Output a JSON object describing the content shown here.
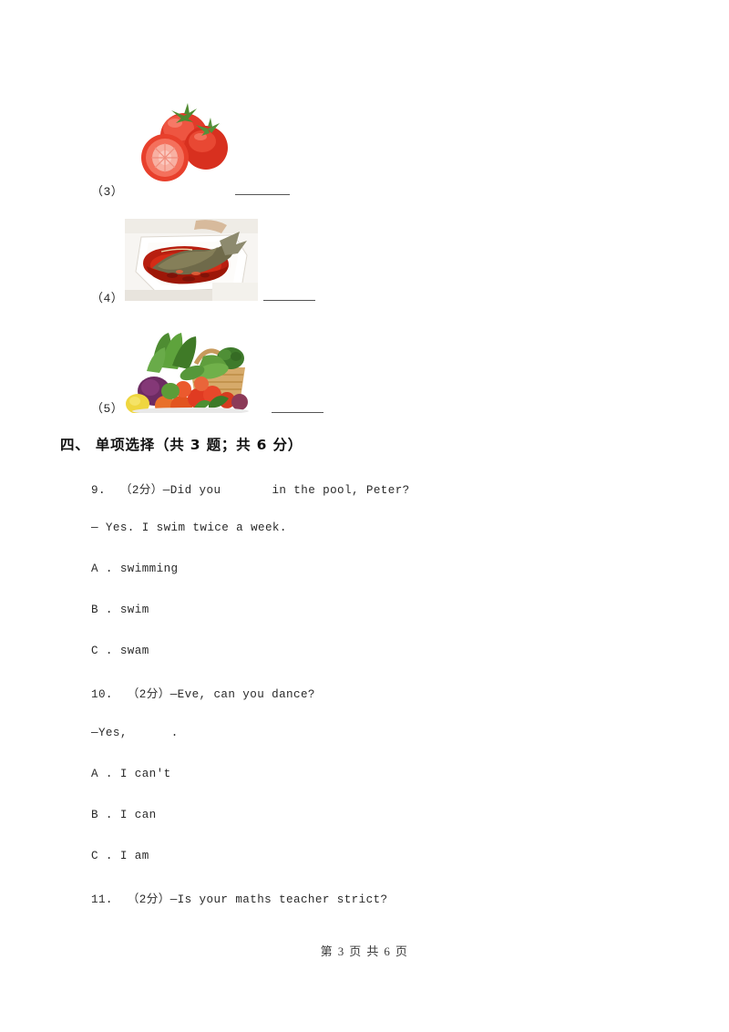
{
  "document": {
    "type": "exam-paper",
    "background_color": "#ffffff",
    "text_color": "#2a2a2a"
  },
  "picture_items": [
    {
      "label": "（3）",
      "image": "tomatoes-photo",
      "image_alt": "Three red tomatoes, one sliced in half",
      "blank": ""
    },
    {
      "label": "（4）",
      "image": "braised-fish-photo",
      "image_alt": "Braised fish in red sauce on a white plate",
      "blank": ""
    },
    {
      "label": "（5）",
      "image": "vegetable-basket-photo",
      "image_alt": "Basket of assorted fresh vegetables and fruit",
      "blank": ""
    }
  ],
  "section": {
    "heading": "四、 单项选择（共 3 题；共 6 分）"
  },
  "questions": [
    {
      "number": "9.",
      "points": "（2分）",
      "stem_before": "—Did you",
      "stem_after": "in the pool, Peter?",
      "stem_second_line": "— Yes. I swim twice a week.",
      "options": [
        "A . swimming",
        "B . swim",
        "C . swam"
      ]
    },
    {
      "number": "10.",
      "points": "（2分）",
      "stem_before": "—Eve, can you dance?",
      "stem_after": "",
      "stem_second_line": "—Yes,",
      "stem_second_tail": ".",
      "options": [
        "A . I can't",
        "B . I can",
        "C . I am"
      ]
    },
    {
      "number": "11.",
      "points": "（2分）",
      "stem_before": "—Is your maths teacher strict?",
      "stem_after": "",
      "options": []
    }
  ],
  "lines": {
    "q9_line1": "9.  （2分）—Did you",
    "q9_line1_tail": "in the pool, Peter?",
    "q9_line2": "— Yes. I swim twice a week.",
    "q9_a": "A . swimming",
    "q9_b": "B . swim",
    "q9_c": "C . swam",
    "q10_line1": "10.  （2分）—Eve, can you dance?",
    "q10_line2": "—Yes,",
    "q10_line2_tail": ".",
    "q10_a": "A . I can't",
    "q10_b": "B . I can",
    "q10_c": "C . I am",
    "q11_line1": "11.  （2分）—Is your maths teacher strict?"
  },
  "footer": {
    "text": "第 3 页 共 6 页",
    "current_page": "3",
    "total_pages": "6"
  }
}
